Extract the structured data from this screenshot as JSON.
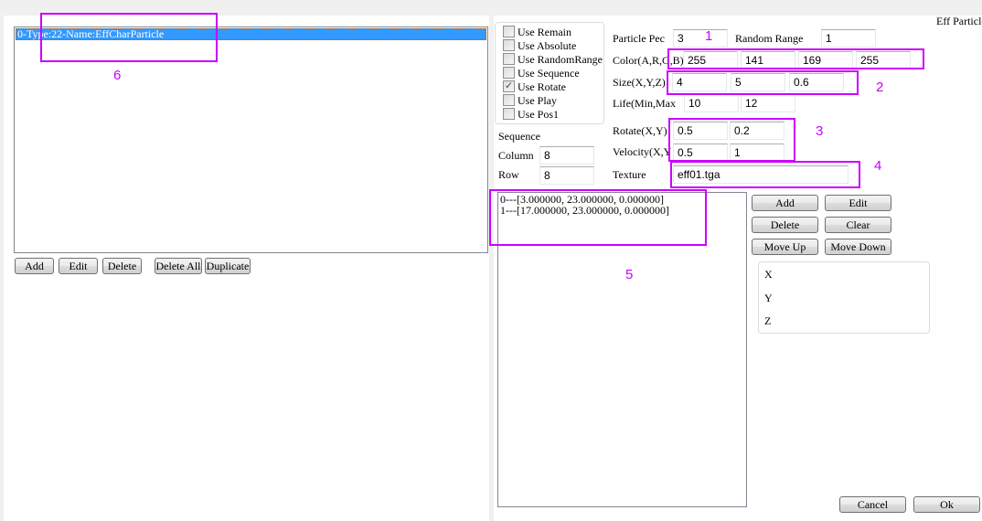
{
  "window": {
    "title": "Eff Particle"
  },
  "left": {
    "list_items": [
      {
        "label": "0-Type:22-Name:EffCharParticle",
        "selected": true
      }
    ],
    "buttons": {
      "add": "Add",
      "edit": "Edit",
      "delete": "Delete",
      "delete_all": "Delete All",
      "duplicate": "Duplicate"
    }
  },
  "options": {
    "checkboxes": [
      {
        "label": "Use Remain",
        "checked": false
      },
      {
        "label": "Use Absolute",
        "checked": false
      },
      {
        "label": "Use RandomRange",
        "checked": false
      },
      {
        "label": "Use Sequence",
        "checked": false
      },
      {
        "label": "Use Rotate",
        "checked": true
      },
      {
        "label": "Use Play",
        "checked": false
      },
      {
        "label": "Use Pos1",
        "checked": false
      }
    ],
    "sequence": {
      "title": "Sequence",
      "column_label": "Column",
      "column_value": "8",
      "row_label": "Row",
      "row_value": "8"
    }
  },
  "properties": {
    "particle_pec_label": "Particle Pec",
    "particle_pec": "3",
    "random_range_label": "Random Range",
    "random_range": "1",
    "color_label": "Color(A,R,G,B)",
    "color": [
      "255",
      "141",
      "169",
      "255"
    ],
    "size_label": "Size(X,Y,Z)",
    "size": [
      "4",
      "5",
      "0.6"
    ],
    "life_label": "Life(Min,Max",
    "life": [
      "10",
      "12"
    ],
    "rotate_label": "Rotate(X,Y)",
    "rotate": [
      "0.5",
      "0.2"
    ],
    "velocity_label": "Velocity(X,Y",
    "velocity": [
      "0.5",
      "1"
    ],
    "texture_label": "Texture",
    "texture": "eff01.tga"
  },
  "positions": {
    "items": [
      "0---[3.000000, 23.000000, 0.000000]",
      "1---[17.000000, 23.000000, 0.000000]"
    ],
    "buttons": {
      "add": "Add",
      "edit": "Edit",
      "delete": "Delete",
      "clear": "Clear",
      "move_up": "Move Up",
      "move_down": "Move Down"
    },
    "axes": [
      "X",
      "Y",
      "Z"
    ]
  },
  "dialog": {
    "cancel": "Cancel",
    "ok": "Ok"
  },
  "annotations": {
    "color": "#cc00ff",
    "labels": [
      "1",
      "2",
      "3",
      "4",
      "5",
      "6"
    ]
  }
}
